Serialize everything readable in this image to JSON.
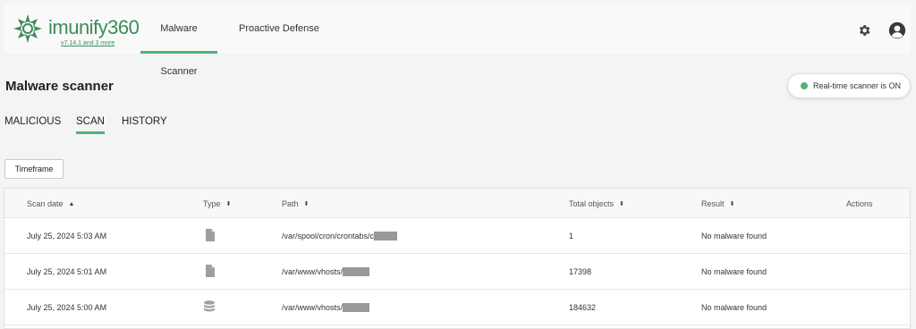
{
  "app": {
    "logo_text": "imunify360",
    "version": "v7.14.1 and 3 more"
  },
  "nav": {
    "tabs": [
      {
        "label": "Malware Scanner",
        "active": true
      },
      {
        "label": "Proactive Defense",
        "active": false
      }
    ]
  },
  "header_icons": [
    "gear-icon",
    "user-avatar-icon"
  ],
  "page": {
    "title": "Malware scanner",
    "realtime_status": "Real-time scanner is ON"
  },
  "sub_tabs": [
    {
      "label": "MALICIOUS",
      "active": false
    },
    {
      "label": "SCAN",
      "active": true
    },
    {
      "label": "HISTORY",
      "active": false
    }
  ],
  "filter": {
    "timeframe_label": "Timeframe"
  },
  "table": {
    "columns": [
      "Scan date",
      "Type",
      "Path",
      "Total objects",
      "Result",
      "Actions"
    ],
    "rows": [
      {
        "scan_date": "July 25, 2024 5:03 AM",
        "type_icon": "file-icon",
        "path": "/var/spool/cron/crontabs/c",
        "total": "1",
        "result": "No malware found"
      },
      {
        "scan_date": "July 25, 2024 5:01 AM",
        "type_icon": "file-icon",
        "path": "/var/www/vhosts/",
        "total": "17398",
        "result": "No malware found"
      },
      {
        "scan_date": "July 25, 2024 5:00 AM",
        "type_icon": "database-icon",
        "path": "/var/www/vhosts/",
        "total": "184632",
        "result": "No malware found"
      }
    ]
  },
  "colors": {
    "accent": "#4fb377",
    "brand": "#3c8c5a"
  }
}
